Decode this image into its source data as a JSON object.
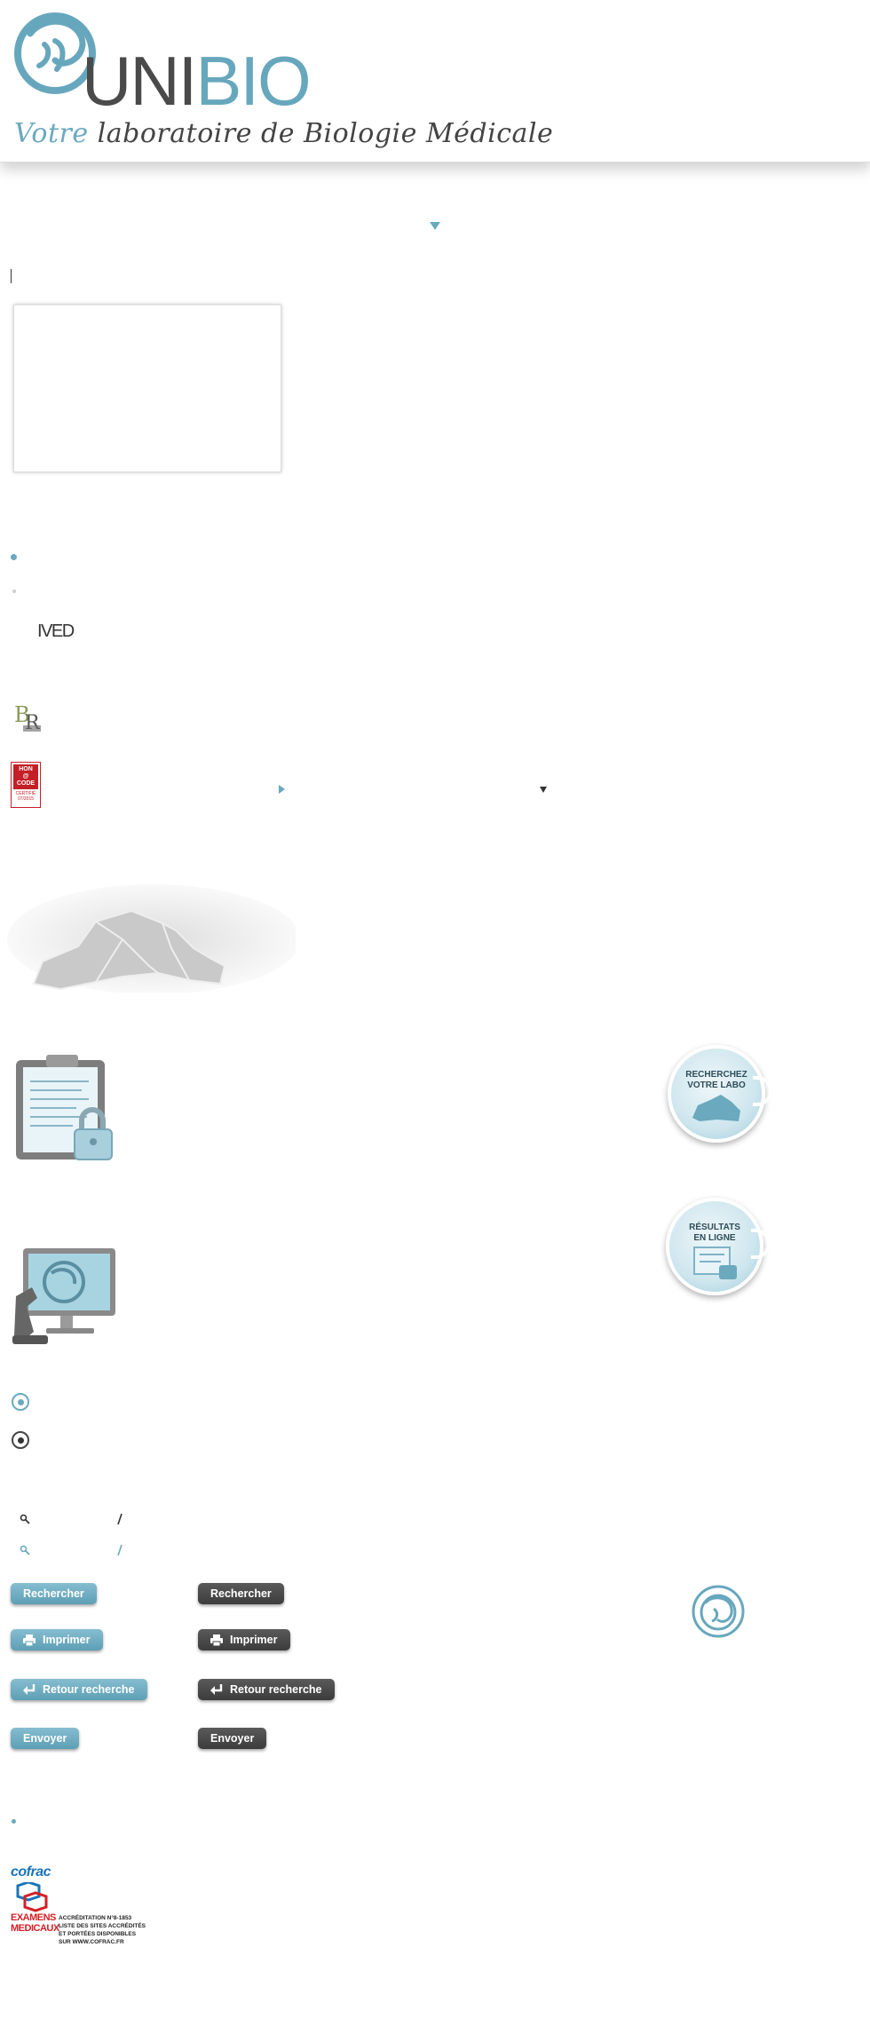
{
  "header": {
    "brand_part1": "UNI",
    "brand_part2": "BIO",
    "tagline_part1": "Votre",
    "tagline_part2": "laboratoire de Biologie Médicale"
  },
  "partners": {
    "med_logo": "IVED",
    "hon_logo_lines": [
      "HON",
      "@",
      "CODE",
      "CERTIFIÉ",
      "07/2015"
    ]
  },
  "bubbles": {
    "search_lab": [
      "RECHERCHEZ",
      "VOTRE LABO"
    ],
    "results_online": [
      "RÉSULTATS",
      "EN LIGNE"
    ]
  },
  "buttons": {
    "search": "Rechercher",
    "print": "Imprimer",
    "back": "Retour recherche",
    "send": "Envoyer"
  },
  "cofrac": {
    "brand": "cofrac",
    "category_line1": "EXAMENS",
    "category_line2": "MEDICAUX",
    "accreditation_lines": [
      "ACCRÉDITATION N°8-1853",
      "LISTE DES SITES ACCRÉDITÉS",
      "ET PORTÉES DISPONIBLES",
      "SUR WWW.COFRAC.FR"
    ]
  },
  "colors": {
    "accent": "#67a7bd",
    "dark": "#444444",
    "hon_red": "#c41f26",
    "cofrac_blue": "#1a74b9",
    "cofrac_red": "#d42027"
  },
  "icons": [
    "unibio-swirl-icon",
    "caret-down-icon",
    "caret-right-icon",
    "search-icon",
    "pencil-icon",
    "printer-icon",
    "return-arrow-icon",
    "map-icon",
    "clipboard-lock-icon",
    "computer-microscope-icon"
  ]
}
